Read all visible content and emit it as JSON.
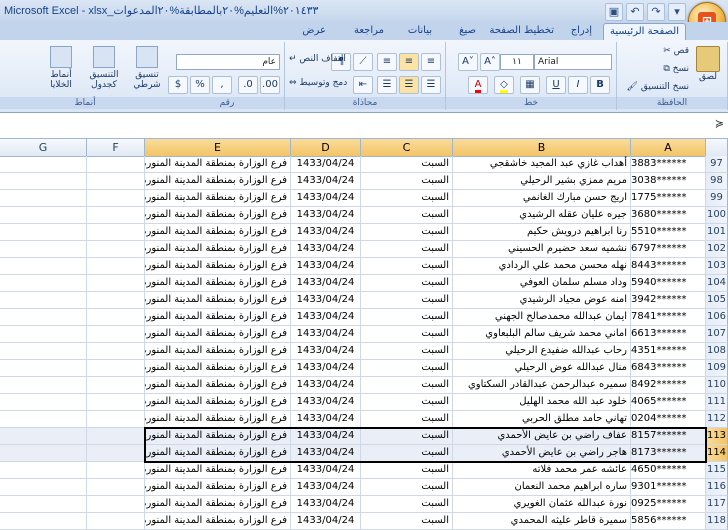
{
  "window": {
    "title": "Microsoft Excel - xlsx_٢٠١٤٣٣%التعليم%٢٠بالمطابقة%٢٠المدعوات"
  },
  "qat": [
    {
      "icon": "save-icon",
      "glyph": "▣"
    },
    {
      "icon": "undo-icon",
      "glyph": "↶"
    },
    {
      "icon": "redo-icon",
      "glyph": "↷"
    },
    {
      "icon": "dropdown-icon",
      "glyph": "▾"
    }
  ],
  "tabs": [
    {
      "label": "الصفحة الرئيسية"
    },
    {
      "label": "إدراج"
    },
    {
      "label": "تخطيط الصفحة"
    },
    {
      "label": "صيغ"
    },
    {
      "label": "بيانات"
    },
    {
      "label": "مراجعة"
    },
    {
      "label": "عرض"
    }
  ],
  "ribbon": {
    "clipboard": {
      "name": "الحافظة",
      "paste": "لصق",
      "cut": "قص",
      "copy": "نسخ",
      "format_painter": "نسخ التنسيق"
    },
    "font": {
      "name": "خط",
      "font_name": "Arial",
      "font_size": "١١",
      "bold": "B",
      "italic": "I",
      "underline": "U"
    },
    "alignment": {
      "name": "محاذاة",
      "wrap": "التفاف النص",
      "merge": "دمج وتوسيط"
    },
    "number": {
      "name": "رقم",
      "format": "عام",
      "percent": "%",
      "comma": ","
    },
    "styles": {
      "name": "أنماط",
      "cond_format": "تنسيق شرطي",
      "format_table": "التنسيق كجدول",
      "cell_styles": "أنماط الخلايا"
    }
  },
  "columns": [
    "A",
    "B",
    "C",
    "D",
    "E",
    "F",
    "G"
  ],
  "rows": [
    {
      "n": "97",
      "a": "3883******",
      "b": "أهداب غازي عبد المجيد خاشقجي",
      "c": "السبت",
      "d": "1433/04/24",
      "e": "فرع الوزارة بمنطقة المدينة المنورة"
    },
    {
      "n": "98",
      "a": "3038******",
      "b": "مريم ممزي بشير الرحيلي",
      "c": "السبت",
      "d": "1433/04/24",
      "e": "فرع الوزارة بمنطقة المدينة المنورة"
    },
    {
      "n": "99",
      "a": "1775******",
      "b": "اريج حسن مبارك الغانمي",
      "c": "السبت",
      "d": "1433/04/24",
      "e": "فرع الوزارة بمنطقة المدينة المنورة"
    },
    {
      "n": "100",
      "a": "3680******",
      "b": "جيره عليان عقله الرشيدي",
      "c": "السبت",
      "d": "1433/04/24",
      "e": "فرع الوزارة بمنطقة المدينة المنورة"
    },
    {
      "n": "101",
      "a": "5510******",
      "b": "رنا ابراهيم درويش حكيم",
      "c": "السبت",
      "d": "1433/04/24",
      "e": "فرع الوزارة بمنطقة المدينة المنورة"
    },
    {
      "n": "102",
      "a": "6797******",
      "b": "نشميه سعد حضيرم الحسيني",
      "c": "السبت",
      "d": "1433/04/24",
      "e": "فرع الوزارة بمنطقة المدينة المنورة"
    },
    {
      "n": "103",
      "a": "8443******",
      "b": "نهله محسن محمد علي الردادي",
      "c": "السبت",
      "d": "1433/04/24",
      "e": "فرع الوزارة بمنطقة المدينة المنورة"
    },
    {
      "n": "104",
      "a": "5940******",
      "b": "وداد مسلم سلمان العوفي",
      "c": "السبت",
      "d": "1433/04/24",
      "e": "فرع الوزارة بمنطقة المدينة المنورة"
    },
    {
      "n": "105",
      "a": "3942******",
      "b": "امنه عوض مجياد الرشيدي",
      "c": "السبت",
      "d": "1433/04/24",
      "e": "فرع الوزارة بمنطقة المدينة المنورة"
    },
    {
      "n": "106",
      "a": "7841******",
      "b": "ايمان عبدالله محمدصالح الجهني",
      "c": "السبت",
      "d": "1433/04/24",
      "e": "فرع الوزارة بمنطقة المدينة المنورة"
    },
    {
      "n": "107",
      "a": "6613******",
      "b": "اماني محمد شريف سالم البلبعاوي",
      "c": "السبت",
      "d": "1433/04/24",
      "e": "فرع الوزارة بمنطقة المدينة المنورة"
    },
    {
      "n": "108",
      "a": "4351******",
      "b": "رحاب عبدالله ضفيدع الرحيلي",
      "c": "السبت",
      "d": "1433/04/24",
      "e": "فرع الوزارة بمنطقة المدينة المنورة"
    },
    {
      "n": "109",
      "a": "6843******",
      "b": "منال عبدالله عوض الرحيلي",
      "c": "السبت",
      "d": "1433/04/24",
      "e": "فرع الوزارة بمنطقة المدينة المنورة"
    },
    {
      "n": "110",
      "a": "8492******",
      "b": "سميره عبدالرحمن عبدالقادر السكتاوي",
      "c": "السبت",
      "d": "1433/04/24",
      "e": "فرع الوزارة بمنطقة المدينة المنورة"
    },
    {
      "n": "111",
      "a": "4065******",
      "b": "خلود عبد الله محمد الهليل",
      "c": "السبت",
      "d": "1433/04/24",
      "e": "فرع الوزارة بمنطقة المدينة المنورة"
    },
    {
      "n": "112",
      "a": "0204******",
      "b": "تهاني حامد مطلق الحربي",
      "c": "السبت",
      "d": "1433/04/24",
      "e": "فرع الوزارة بمنطقة المدينة المنورة"
    },
    {
      "n": "113",
      "a": "8157******",
      "b": "عفاف راضي بن عايض الأحمدي",
      "c": "السبت",
      "d": "1433/04/24",
      "e": "فرع الوزارة بمنطقة المدينة المنورة",
      "sel": true
    },
    {
      "n": "114",
      "a": "8173******",
      "b": "هاجر راضي بن عايض الأحمدي",
      "c": "السبت",
      "d": "1433/04/24",
      "e": "فرع الوزارة بمنطقة المدينة المنورة",
      "sel": true
    },
    {
      "n": "115",
      "a": "4650******",
      "b": "عائشه عمر محمد فلاته",
      "c": "السبت",
      "d": "1433/04/24",
      "e": "فرع الوزارة بمنطقة المدينة المنورة"
    },
    {
      "n": "116",
      "a": "9301******",
      "b": "ساره ابراهيم محمد النعمان",
      "c": "السبت",
      "d": "1433/04/24",
      "e": "فرع الوزارة بمنطقة المدينة المنورة"
    },
    {
      "n": "117",
      "a": "0925******",
      "b": "نورة عبدالله عثمان الغويري",
      "c": "السبت",
      "d": "1433/04/24",
      "e": "فرع الوزارة بمنطقة المدينة المنورة"
    },
    {
      "n": "118",
      "a": "5856******",
      "b": "سميرة قاطر عليثه المحمدي",
      "c": "السبت",
      "d": "1433/04/24",
      "e": "فرع الوزارة بمنطقة المدينة المنورة"
    }
  ]
}
